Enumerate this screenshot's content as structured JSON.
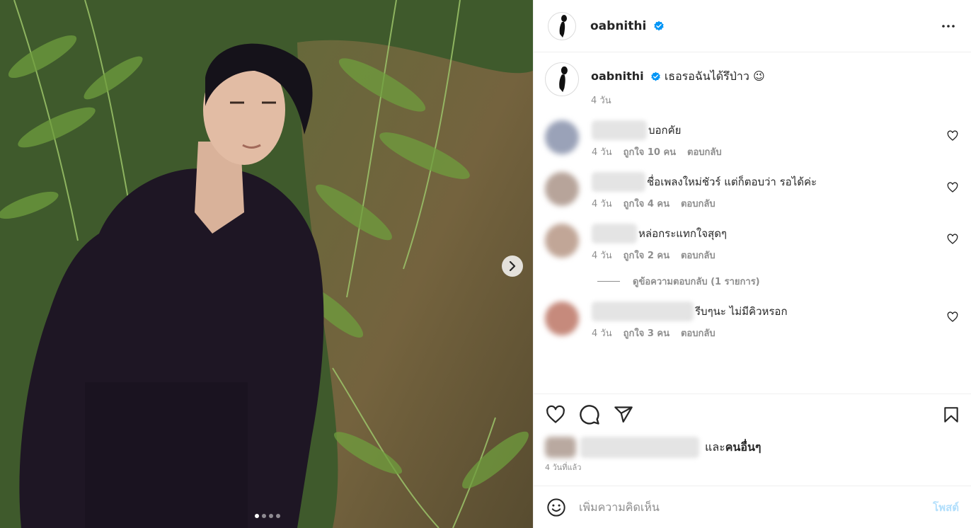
{
  "post": {
    "username": "oabnithi",
    "caption_text": "เธอรอฉันได้รึป่าว",
    "caption_emoji": "😉",
    "caption_time": "4 วัน",
    "post_time": "4 วันที่แล้ว",
    "likes_text": "และ",
    "likes_bold": "คนอื่นๆ",
    "media_slide": 1,
    "media_slide_count": 4
  },
  "comments": [
    {
      "text": "บอกคัย",
      "time": "4 วัน",
      "likes": "ถูกใจ 10 คน",
      "reply": "ตอบกลับ"
    },
    {
      "text": "ชื่อเพลงใหม่ชัวร์ แต่ก็ตอบว่า รอได้ค่ะ",
      "time": "4 วัน",
      "likes": "ถูกใจ 4 คน",
      "reply": "ตอบกลับ"
    },
    {
      "text": "หล่อกระแทกใจสุดๆ",
      "time": "4 วัน",
      "likes": "ถูกใจ 2 คน",
      "reply": "ตอบกลับ"
    },
    {
      "text": "รีบๆนะ ไม่มีคิวหรอก",
      "time": "4 วัน",
      "likes": "ถูกใจ 3 คน",
      "reply": "ตอบกลับ"
    }
  ],
  "view_replies": "ดูข้อความตอบกลับ (1 รายการ)",
  "add_comment": {
    "placeholder": "เพิ่มความคิดเห็น",
    "post_label": "โพสต์"
  },
  "colors": {
    "verified": "#0095f6",
    "muted": "#8e8e8e",
    "post_button": "#b2dffc"
  },
  "icons": [
    "verified-badge-icon",
    "more-options-icon",
    "heart-icon",
    "comment-icon",
    "share-icon",
    "bookmark-icon",
    "emoji-icon",
    "chevron-right-icon"
  ]
}
